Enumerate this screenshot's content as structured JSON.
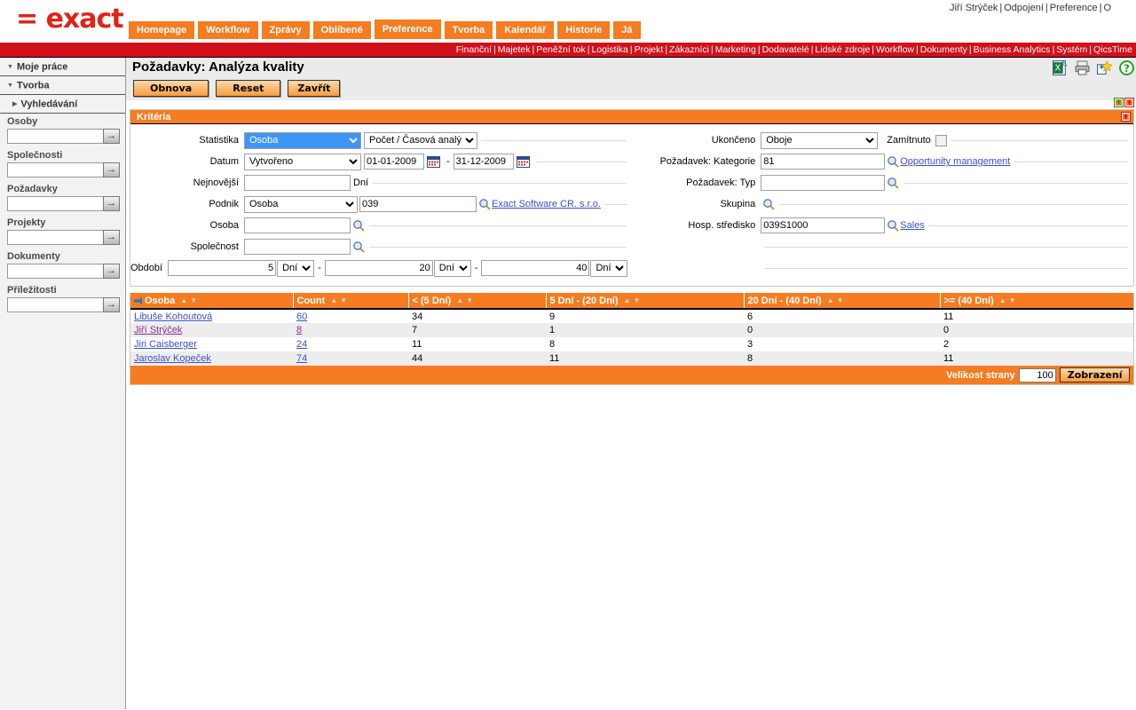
{
  "user_bar": {
    "user": "Jiří Strýček",
    "links": [
      "Odpojení",
      "Preference",
      "O"
    ],
    "separator": "|"
  },
  "brand": {
    "logo_text": "= exact"
  },
  "tabs": [
    {
      "label": "Homepage",
      "active": false
    },
    {
      "label": "Workflow",
      "active": false
    },
    {
      "label": "Zprávy",
      "active": false
    },
    {
      "label": "Oblíbené",
      "active": false
    },
    {
      "label": "Preference",
      "active": true
    },
    {
      "label": "Tvorba",
      "active": false
    },
    {
      "label": "Kalendář",
      "active": false
    },
    {
      "label": "Historie",
      "active": false
    },
    {
      "label": "Já",
      "active": false
    }
  ],
  "module_menu": {
    "separator": "|",
    "items": [
      "Finanční",
      "Majetek",
      "Peněžní tok",
      "Logistika",
      "Projekt",
      "Zákazníci",
      "Marketing",
      "Dodavatelé",
      "Lidské zdroje",
      "Workflow",
      "Dokumenty",
      "Business Analytics",
      "Systém",
      "QicsTime"
    ]
  },
  "sidebar": {
    "groups": [
      {
        "label": "Moje práce",
        "expanded": true,
        "sub": false
      },
      {
        "label": "Tvorba",
        "expanded": true,
        "sub": false
      },
      {
        "label": "Vyhledávání",
        "expanded": false,
        "sub": true
      }
    ],
    "search_fields": [
      {
        "label": "Osoby",
        "value": "",
        "go": "→"
      },
      {
        "label": "Společnosti",
        "value": "",
        "go": "→"
      },
      {
        "label": "Požadavky",
        "value": "",
        "go": "→"
      },
      {
        "label": "Projekty",
        "value": "",
        "go": "→"
      },
      {
        "label": "Dokumenty",
        "value": "",
        "go": "→"
      },
      {
        "label": "Příležitosti",
        "value": "",
        "go": "→"
      }
    ]
  },
  "page": {
    "title": "Požadavky: Analýza kvality",
    "icons": [
      "excel-export-icon",
      "print-icon",
      "add-favorite-icon",
      "help-icon"
    ]
  },
  "toolbar": {
    "refresh_label": "Obnova",
    "reset_label": "Reset",
    "close_label": "Zavřít"
  },
  "criteria": {
    "panel_title": "Kritéria",
    "left": {
      "statistika_label": "Statistika",
      "statistika_value": "Osoba",
      "statistika_mode_value": "Počet / Časová analýza",
      "datum_label": "Datum",
      "datum_type_value": "Vytvořeno",
      "datum_from": "01-01-2009",
      "datum_to": "31-12-2009",
      "datum_dash": "-",
      "nejnovejsi_label": "Nejnovější",
      "nejnovejsi_value": "",
      "nejnovejsi_unit": "Dní",
      "podnik_label": "Podnik",
      "podnik_type_value": "Osoba",
      "podnik_code": "039",
      "podnik_link": "Exact Software CR. s.r.o.",
      "osoba_label": "Osoba",
      "osoba_value": "",
      "spolecnost_label": "Společnost",
      "spolecnost_value": "",
      "obdobi_label": "Období",
      "obdobi_1_value": "5",
      "obdobi_1_unit": "Dní",
      "obdobi_2_value": "20",
      "obdobi_2_unit": "Dní",
      "obdobi_3_value": "40",
      "obdobi_3_unit": "Dní",
      "obdobi_dash": "-"
    },
    "right": {
      "ukonceno_label": "Ukončeno",
      "ukonceno_value": "Oboje",
      "zamitnuto_label": "Zamítnuto",
      "zamitnuto_checked": false,
      "kategorie_label": "Požadavek: Kategorie",
      "kategorie_value": "81",
      "kategorie_link": "Opportunity management",
      "typ_label": "Požadavek: Typ",
      "typ_value": "",
      "skupina_label": "Skupina",
      "hosp_label": "Hosp. středisko",
      "hosp_value": "039S1000",
      "hosp_link": "Sales"
    }
  },
  "chart_data": {
    "type": "table",
    "title": "Požadavky: Analýza kvality",
    "categories": [
      "Libuše Kohoutová",
      "Jiří Strýček",
      "Jiri Caisberger",
      "Jaroslav Kopeček"
    ],
    "columns": [
      "Osoba",
      "Count",
      "< (5 Dní)",
      "5 Dní - (20 Dní)",
      "20 Dní - (40 Dní)",
      ">= (40 Dní)"
    ],
    "series": [
      {
        "name": "Count",
        "values": [
          60,
          8,
          24,
          74
        ]
      },
      {
        "name": "< (5 Dní)",
        "values": [
          34,
          7,
          11,
          44
        ]
      },
      {
        "name": "5 Dní - (20 Dní)",
        "values": [
          9,
          1,
          8,
          11
        ]
      },
      {
        "name": "20 Dní - (40 Dní)",
        "values": [
          6,
          0,
          3,
          8
        ]
      },
      {
        "name": ">= (40 Dní)",
        "values": [
          11,
          0,
          2,
          11
        ]
      }
    ]
  },
  "table": {
    "headers": [
      {
        "label": "Osoba",
        "pinned": true
      },
      {
        "label": "Count",
        "pinned": false
      },
      {
        "label": "< (5 Dní)",
        "pinned": false
      },
      {
        "label": "5 Dní - (20 Dní)",
        "pinned": false
      },
      {
        "label": "20 Dní - (40 Dní)",
        "pinned": false
      },
      {
        "label": ">= (40 Dní)",
        "pinned": false
      }
    ],
    "rows": [
      {
        "osoba": "Libuše Kohoutová",
        "count": "60",
        "lt5": "34",
        "d5_20": "9",
        "d20_40": "6",
        "gte40": "11",
        "visited": false
      },
      {
        "osoba": "Jiří Strýček",
        "count": "8",
        "lt5": "7",
        "d5_20": "1",
        "d20_40": "0",
        "gte40": "0",
        "visited": true
      },
      {
        "osoba": "Jiri Caisberger",
        "count": "24",
        "lt5": "11",
        "d5_20": "8",
        "d20_40": "3",
        "gte40": "2",
        "visited": false
      },
      {
        "osoba": "Jaroslav Kopeček",
        "count": "74",
        "lt5": "44",
        "d5_20": "11",
        "d20_40": "8",
        "gte40": "11",
        "visited": false
      }
    ],
    "footer": {
      "page_size_label": "Velikost strany",
      "page_size_value": "100",
      "show_button": "Zobrazení"
    }
  },
  "colors": {
    "brand_red": "#e1231a",
    "menu_red": "#d2101b",
    "accent_orange": "#f57c20",
    "link_blue": "#3a50c8",
    "link_visited": "#8b2f8b",
    "row_alt": "#ededed"
  }
}
